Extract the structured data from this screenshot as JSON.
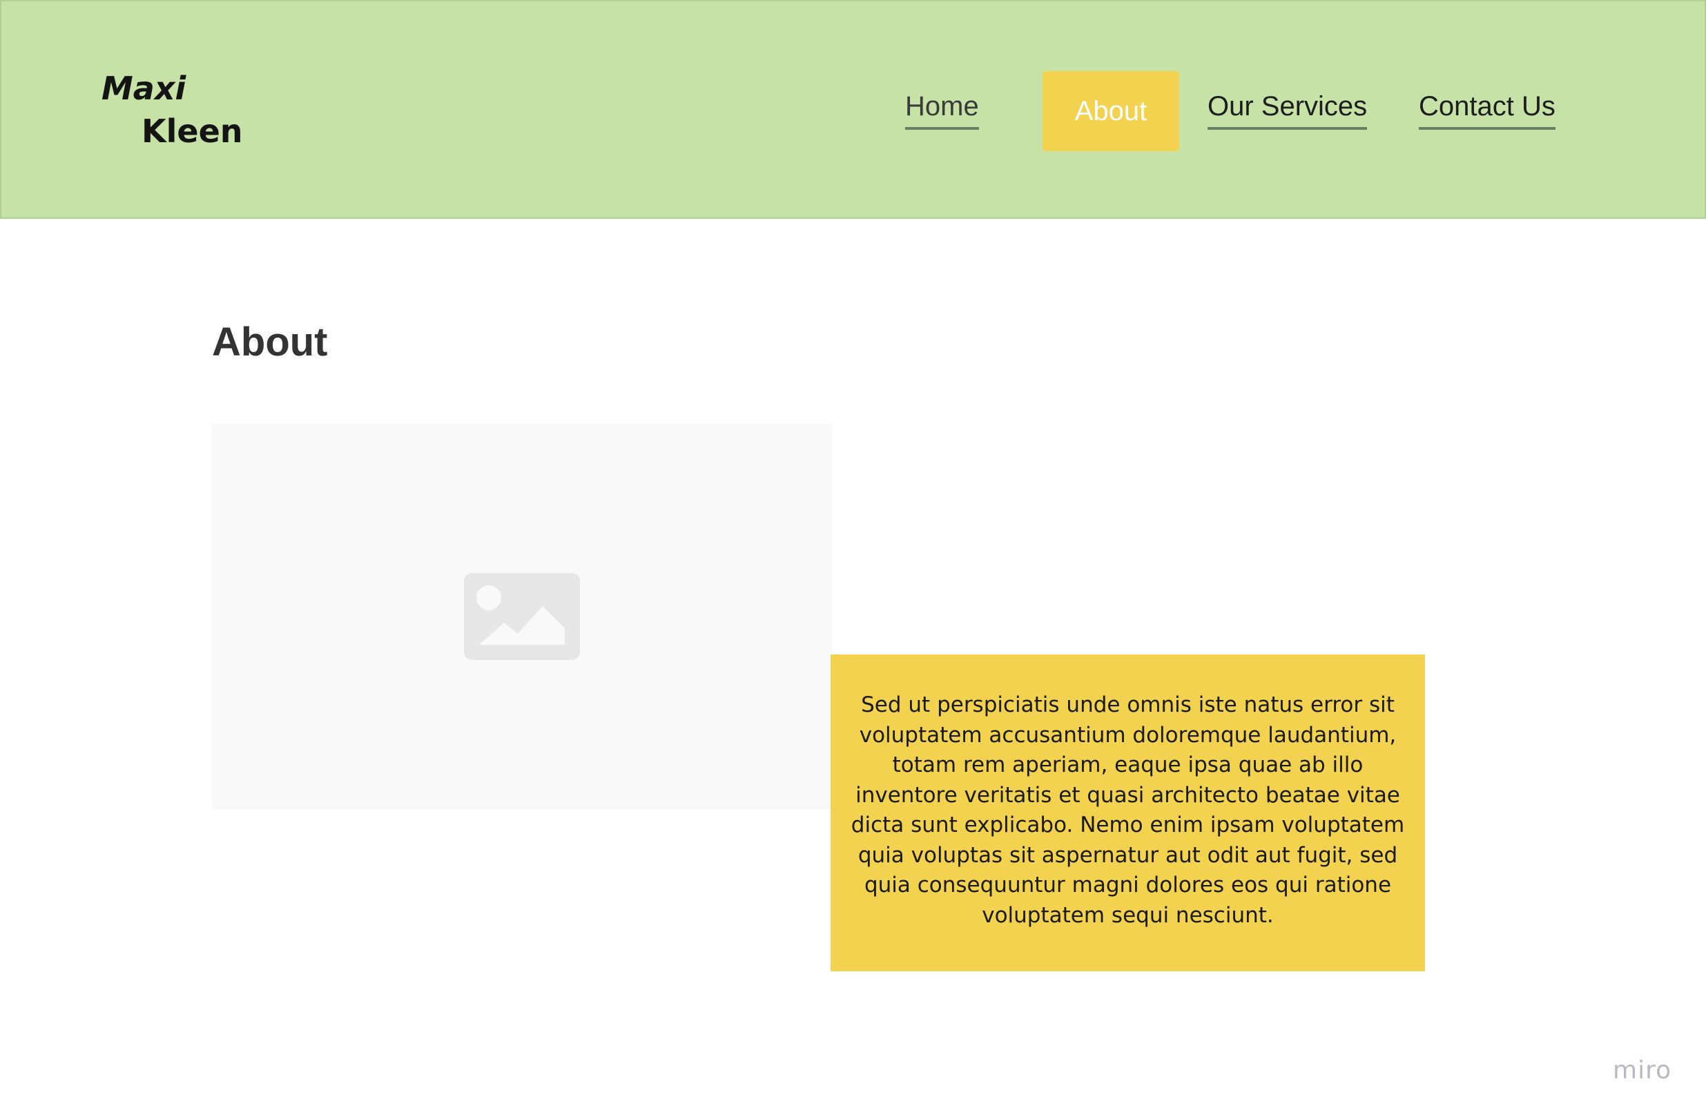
{
  "colors": {
    "header_background": "#c6e2a7",
    "accent": "#f2d24e",
    "active_nav_text": "#ffffff",
    "nav_underline": "#6b7d62",
    "title_text": "#333333",
    "image_placeholder": "#f9f9f9"
  },
  "header": {
    "logo": {
      "line1": "Maxi",
      "line2": "Kleen"
    },
    "nav": {
      "home": "Home",
      "about": "About",
      "services": "Our Services",
      "contact": "Contact Us",
      "active": "about"
    }
  },
  "main": {
    "title": "About",
    "image": {
      "icon": "image-icon"
    },
    "card_text": "Sed ut perspiciatis unde omnis iste natus error sit voluptatem accusantium doloremque laudantium, totam rem aperiam, eaque ipsa quae ab illo inventore veritatis et quasi architecto beatae vitae dicta sunt explicabo. Nemo enim ipsam voluptatem quia voluptas sit aspernatur aut odit aut fugit, sed quia consequuntur magni dolores eos qui ratione voluptatem sequi nesciunt."
  },
  "watermark": "miro"
}
